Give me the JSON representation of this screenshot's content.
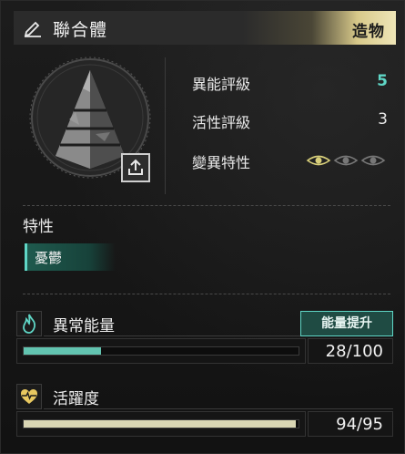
{
  "header": {
    "name": "聯合體",
    "tag": "造物"
  },
  "stats": [
    {
      "label": "異能評級",
      "value": "5",
      "color": "teal"
    },
    {
      "label": "活性評級",
      "value": "3",
      "color": "white"
    },
    {
      "label": "變異特性",
      "eyes_active": 1,
      "eyes_total": 3
    }
  ],
  "traits": {
    "title": "特性",
    "items": [
      "憂鬱"
    ]
  },
  "energy": {
    "title": "異常能量",
    "button_label": "能量提升",
    "current": 28,
    "max": 100,
    "display": "28/100",
    "fill_color": "#62c4b0"
  },
  "activity": {
    "title": "活躍度",
    "current": 94,
    "max": 95,
    "display": "94/95",
    "fill_color": "#d9d6b4"
  },
  "colors": {
    "accent_teal": "#5fd6c6",
    "header_gold": "#efe6b8"
  }
}
